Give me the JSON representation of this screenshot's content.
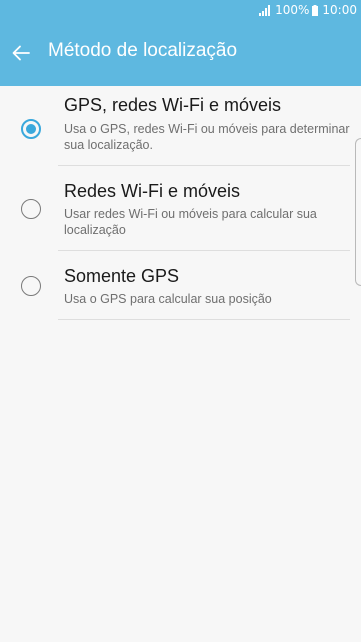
{
  "status_bar": {
    "battery": "100%",
    "time": "10:00",
    "icons": [
      "signal-icon",
      "battery-icon"
    ]
  },
  "app_bar": {
    "back_icon": "back-arrow-icon",
    "title": "Método de localização"
  },
  "options": [
    {
      "title": "GPS, redes Wi-Fi e móveis",
      "description": "Usa o GPS, redes Wi-Fi ou móveis para determinar sua localização.",
      "selected": true
    },
    {
      "title": "Redes Wi-Fi e móveis",
      "description": "Usar redes Wi-Fi ou móveis para calcular sua localização",
      "selected": false
    },
    {
      "title": "Somente GPS",
      "description": "Usa o GPS para calcular sua posição",
      "selected": false
    }
  ],
  "colors": {
    "accent": "#5eb8e0",
    "radio_selected": "#3aa8dc",
    "background": "#f7f7f7"
  }
}
